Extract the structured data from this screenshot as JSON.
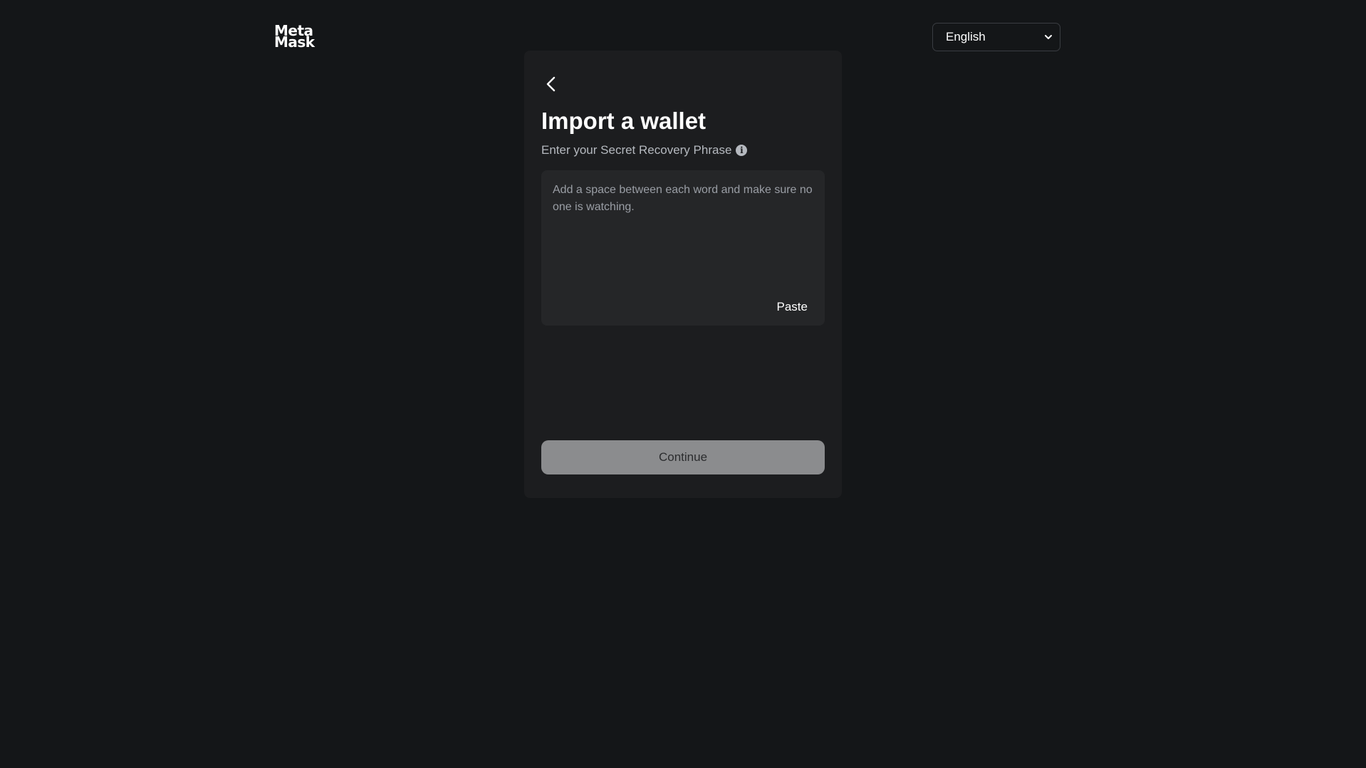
{
  "brand": {
    "logo_line1": "Meta",
    "logo_line2": "Mask"
  },
  "language": {
    "selected": "English"
  },
  "import": {
    "title": "Import a wallet",
    "subtitle": "Enter your Secret Recovery Phrase",
    "phrase_placeholder": "Add a space between each word and make sure no one is watching.",
    "paste_label": "Paste",
    "continue_label": "Continue"
  },
  "icons": {
    "back": "chevron-left-icon",
    "info": "info-icon",
    "dropdown": "chevron-down-icon"
  },
  "colors": {
    "background": "#141618",
    "card": "#1c1d1f",
    "input": "#252628",
    "button_disabled": "#8b8c8e"
  }
}
